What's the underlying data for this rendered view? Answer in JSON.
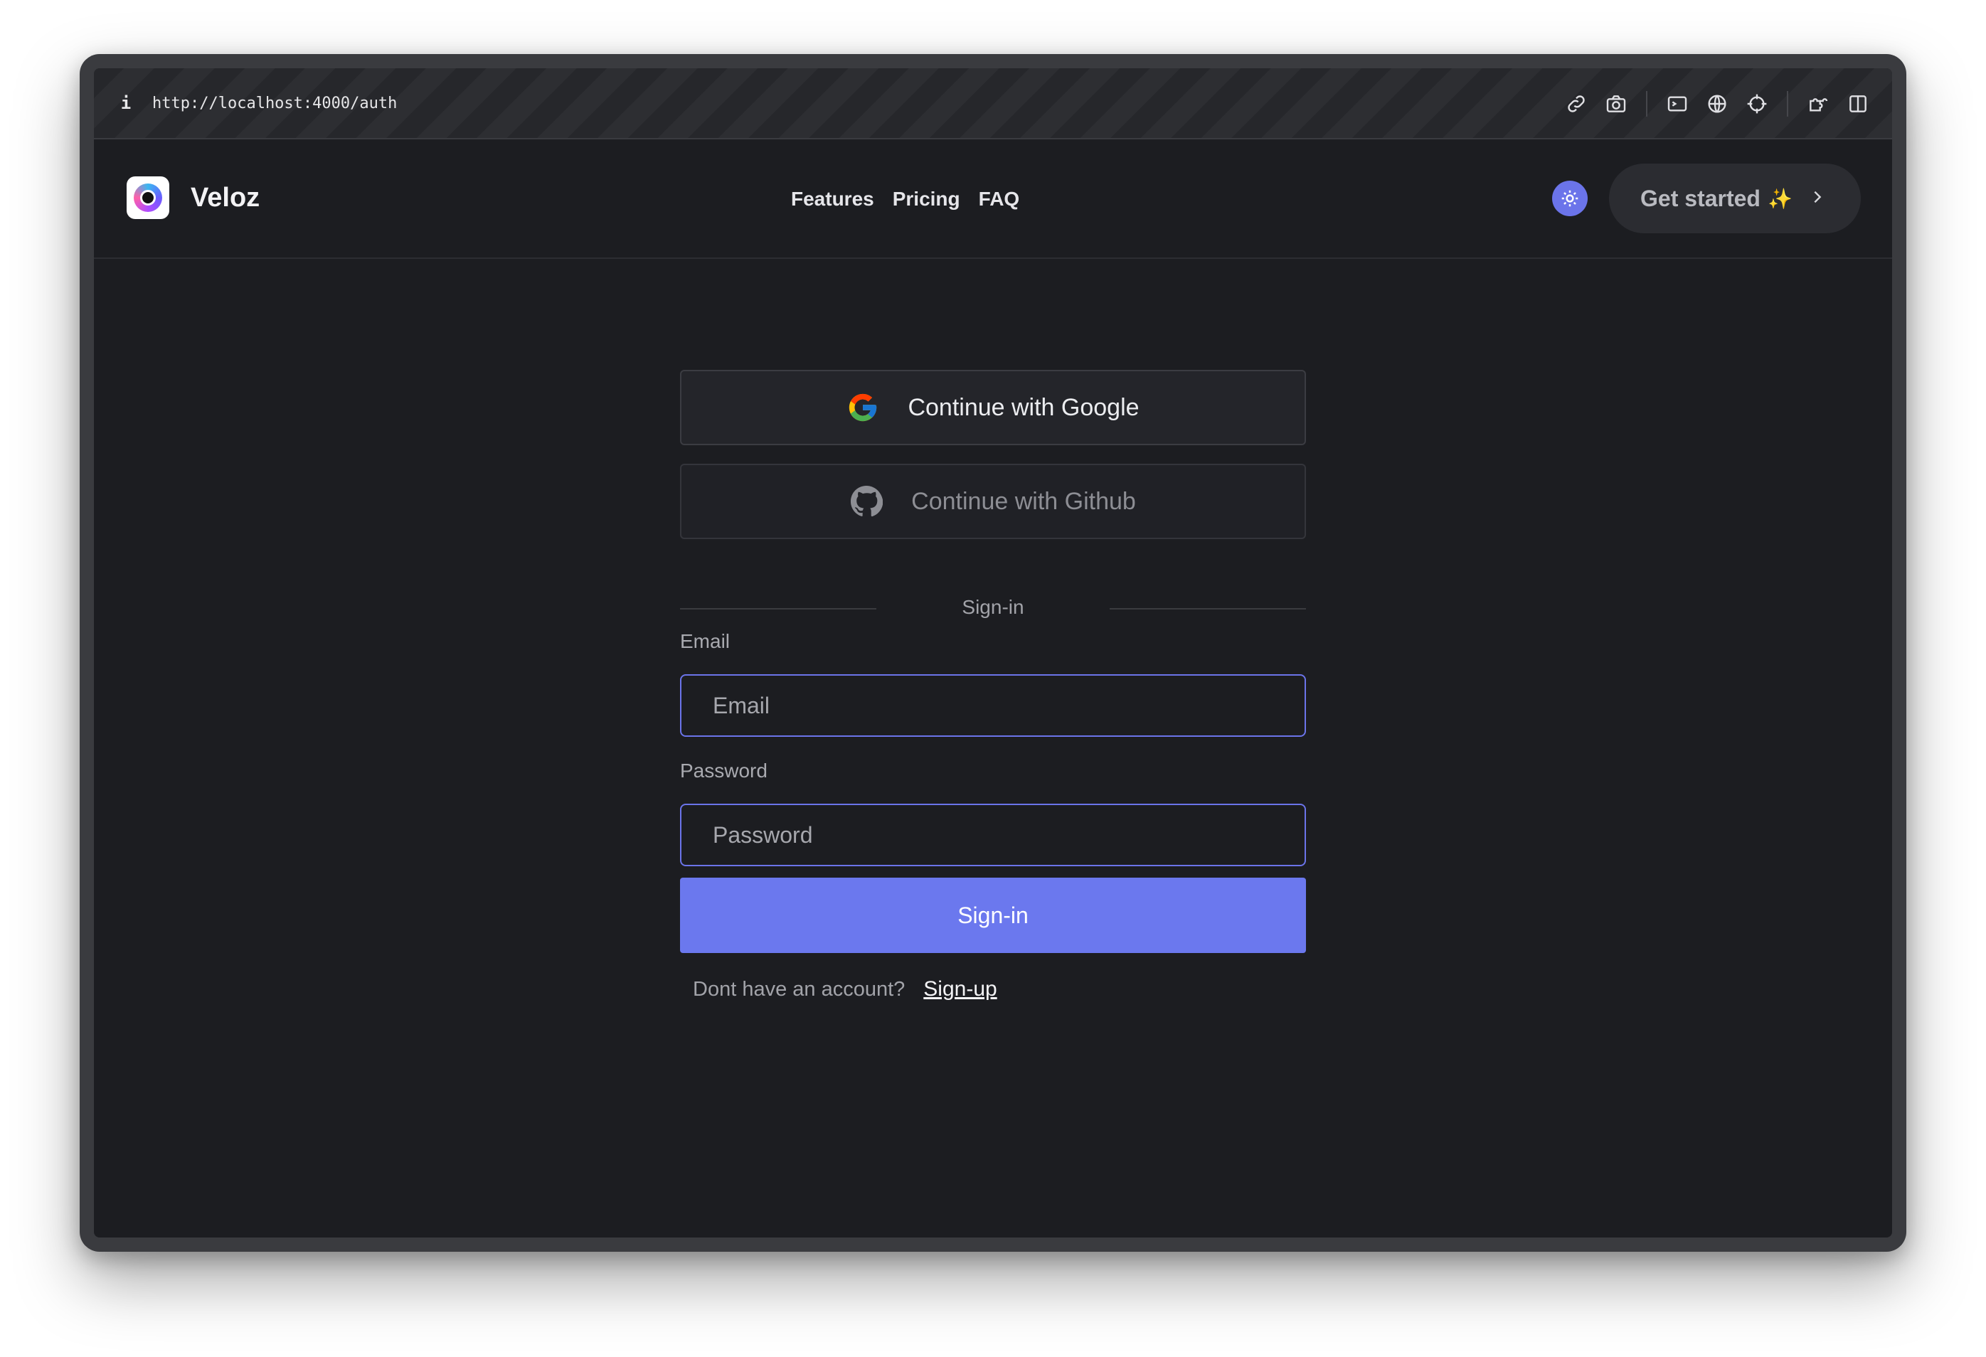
{
  "browser": {
    "url": "http://localhost:4000/auth",
    "info_glyph": "i",
    "toolbar_icons": [
      "link-icon",
      "camera-icon",
      "terminal-icon",
      "globe-icon",
      "crosshair-icon",
      "extensions-icon",
      "split-view-icon"
    ]
  },
  "nav": {
    "brand": "Veloz",
    "links": [
      "Features",
      "Pricing",
      "FAQ"
    ],
    "theme_toggle_icon": "sun-icon",
    "cta_label": "Get started",
    "cta_spark": "✨"
  },
  "auth": {
    "google_label": "Continue with Google",
    "github_label": "Continue with Github",
    "divider_label": "Sign-in",
    "email_label": "Email",
    "email_placeholder": "Email",
    "password_label": "Password",
    "password_placeholder": "Password",
    "submit_label": "Sign-in",
    "no_account_text": "Dont have an account?",
    "signup_link": "Sign-up"
  },
  "colors": {
    "accent": "#6b78ee",
    "background": "#1c1d21",
    "input_border": "#6b74ea"
  }
}
